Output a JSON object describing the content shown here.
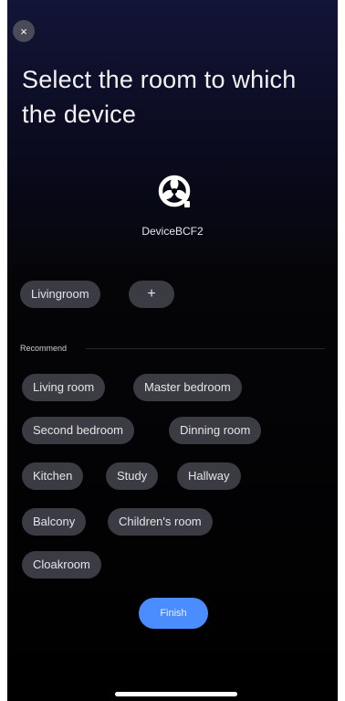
{
  "header": {
    "close_icon": "×",
    "title": "Select the room to which the device"
  },
  "device": {
    "icon": "fan-icon",
    "name": "DeviceBCF2"
  },
  "current_rooms": {
    "selected": "Livingroom",
    "add_label": "+"
  },
  "recommend": {
    "label": "Recommend",
    "rooms": [
      "Living room",
      "Master bedroom",
      "Second bedroom",
      "Dinning room",
      "Kitchen",
      "Study",
      "Hallway",
      "Balcony",
      "Children's room",
      "Cloakroom"
    ]
  },
  "footer": {
    "finish_label": "Finish"
  },
  "colors": {
    "accent": "#4b8dff",
    "chip": "#3b3b44",
    "background": "#000000"
  }
}
